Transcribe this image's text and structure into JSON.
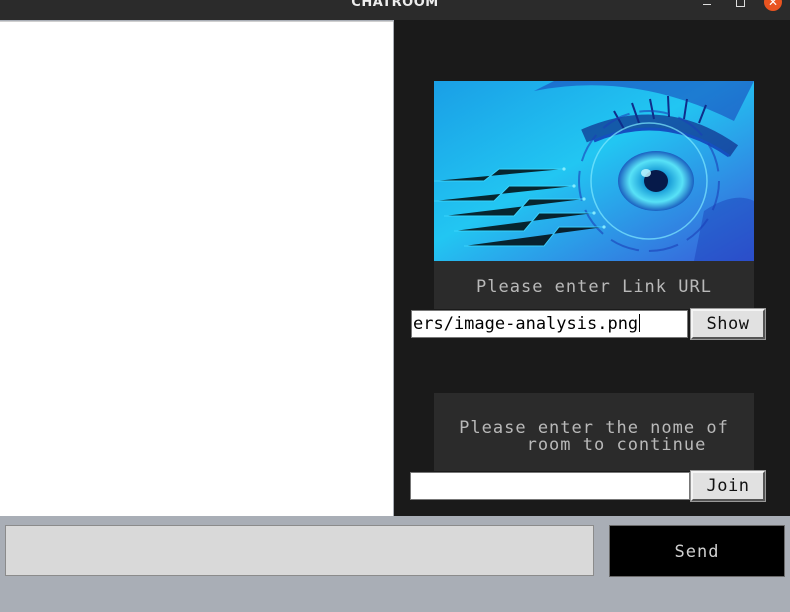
{
  "window": {
    "title": "CHATROOM",
    "close_glyph": "✕"
  },
  "link": {
    "label": "Please enter Link URL",
    "input_value": "ers/image-analysis.png",
    "show_button": "Show"
  },
  "room": {
    "label": "Please enter the nome of\n    room to continue",
    "input_value": "",
    "join_button": "Join"
  },
  "message": {
    "input_value": "",
    "send_button": "Send"
  },
  "banner": {
    "icon": "cyber-eye-image",
    "colors": {
      "primary": "#1ec8f0",
      "secondary": "#1a3fb8"
    }
  },
  "colors": {
    "right_panel_bg": "#1a1a1a",
    "label_bg": "#2b2b2b",
    "bottom_bg": "#a9aeb6",
    "close_button": "#e95420"
  }
}
